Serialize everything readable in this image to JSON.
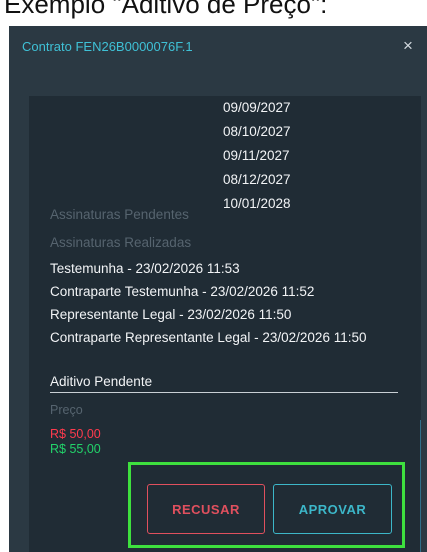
{
  "caption": "Exemplo \"Aditivo de Preço\":",
  "modal": {
    "title": "Contrato FEN26B0000076F.1",
    "close_symbol": "×"
  },
  "dates": [
    "09/09/2027",
    "08/10/2027",
    "09/11/2027",
    "08/12/2027",
    "10/01/2028"
  ],
  "signatures": {
    "pending_label": "Assinaturas Pendentes",
    "done_label": "Assinaturas Realizadas",
    "done": [
      "Testemunha - 23/02/2026 11:53",
      "Contraparte Testemunha - 23/02/2026 11:52",
      "Representante Legal - 23/02/2026 11:50",
      "Contraparte Representante Legal - 23/02/2026 11:50"
    ]
  },
  "aditivo": {
    "title": "Aditivo Pendente",
    "price_label": "Preço",
    "old_price": "R$ 50,00",
    "new_price": "R$ 55,00"
  },
  "actions": {
    "reject_label": "RECUSAR",
    "approve_label": "APROVAR"
  },
  "colors": {
    "modal_bg": "#2b3943",
    "content_bg": "#202c35",
    "title_accent": "#3fc1d6",
    "reject": "#e0505e",
    "approve": "#3cb7c9",
    "old_price": "#ff3b4e",
    "new_price": "#22d36a",
    "highlight": "#3ee03e"
  }
}
